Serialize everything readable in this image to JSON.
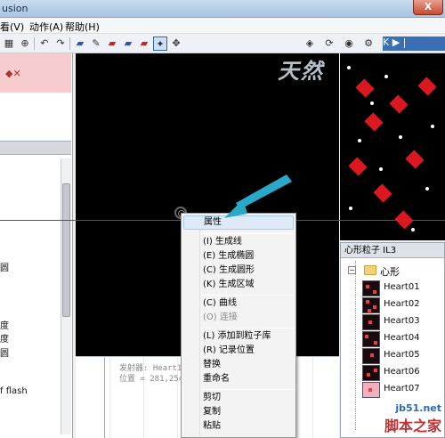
{
  "window": {
    "title": "usion",
    "close_label": "X"
  },
  "menu": {
    "items": [
      "看(V)",
      "动作(A)",
      "帮助(H)"
    ]
  },
  "toolbar": {
    "right_text": "K ▶ |"
  },
  "left_panel": {
    "labels": [
      "圆",
      "度",
      "度",
      "圆",
      "f flash"
    ]
  },
  "canvas": {
    "watermark": "天然",
    "emitter_info": {
      "line1": "发射器: Heart11",
      "line2": "位置 = 281,254"
    }
  },
  "particle_panel": {
    "header": "心形粒子 IL3",
    "folder": "心形",
    "items": [
      "Heart01",
      "Heart02",
      "Heart03",
      "Heart04",
      "Heart05",
      "Heart06",
      "Heart07"
    ]
  },
  "context_menu": {
    "properties": "属性",
    "group1": [
      "(I) 生成线",
      "(E) 生成椭圆",
      "(C) 生成圆形",
      "(K) 生成区域"
    ],
    "curve": "(C) 曲线",
    "connect": "(O) 连接",
    "group3": [
      "(L) 添加到粒子库",
      "(R) 记录位置",
      "替换",
      "重命名"
    ],
    "group4": [
      "剪切",
      "复制",
      "粘贴"
    ]
  },
  "site_watermark": {
    "site": "jb51.net",
    "name": "脚本之家"
  },
  "colors": {
    "canvas_bg": "#000000",
    "highlight": "#dfeaf8",
    "arrow": "#2aa8c8",
    "guide_line": "#cc2222"
  }
}
